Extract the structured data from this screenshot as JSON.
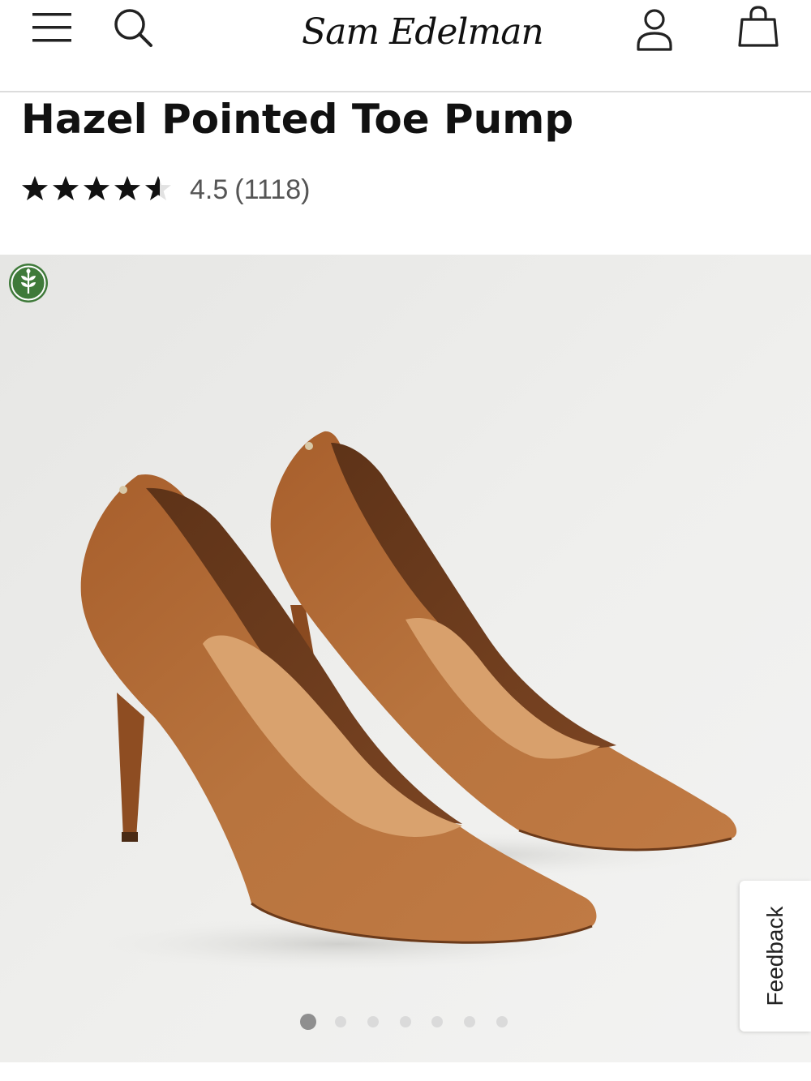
{
  "header": {
    "brand": "Sam Edelman",
    "menu_icon": "hamburger-menu-icon",
    "search_icon": "search-icon",
    "account_icon": "user-account-icon",
    "bag_icon": "shopping-bag-icon"
  },
  "product": {
    "title": "Hazel Pointed Toe Pump",
    "rating": {
      "value": "4.5",
      "count": "(1118)",
      "stars_filled_fraction": 0.9
    }
  },
  "gallery": {
    "badge_icon": "eco-leaf-badge-icon",
    "image_subject": "pair of cognac leather pointed-toe stiletto pumps",
    "slide_count": 7,
    "active_slide": 1
  },
  "feedback": {
    "label": "Feedback"
  },
  "colors": {
    "background": "#ffffff",
    "gallery_bg": "#eeeeec",
    "badge_green": "#3f7a3a",
    "shoe_cognac": "#b06a36",
    "dot_active": "#8f8f8f",
    "dot_inactive": "#dadada"
  }
}
